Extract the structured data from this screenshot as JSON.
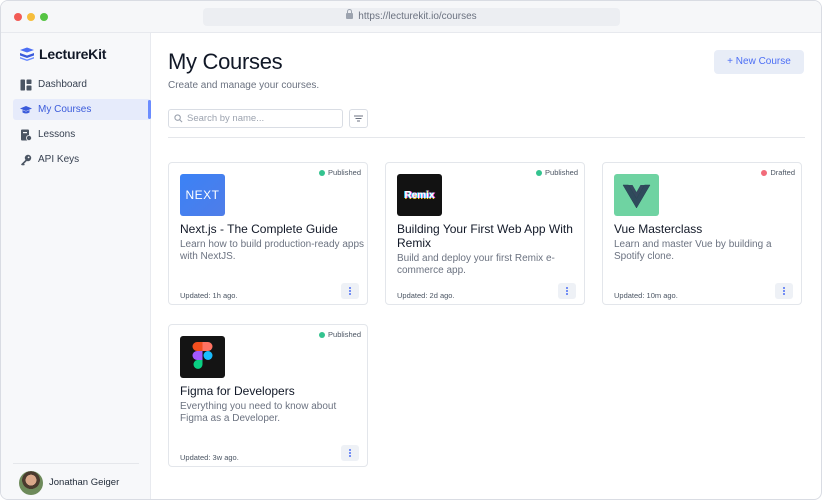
{
  "browser": {
    "url": "https://lecturekit.io/courses"
  },
  "sidebar": {
    "brand": "LectureKit",
    "items": [
      {
        "label": "Dashboard",
        "icon": "dashboard-icon",
        "active": false
      },
      {
        "label": "My Courses",
        "icon": "graduation-cap-icon",
        "active": true
      },
      {
        "label": "Lessons",
        "icon": "lessons-icon",
        "active": false
      },
      {
        "label": "API Keys",
        "icon": "key-icon",
        "active": false
      }
    ],
    "user": {
      "name": "Jonathan Geiger"
    }
  },
  "main": {
    "title": "My Courses",
    "subtitle": "Create and manage your courses.",
    "new_button": "+ New Course",
    "search_placeholder": "Search by name...",
    "courses": [
      {
        "title": "Next.js - The Complete Guide",
        "description": "Learn how to build production-ready apps with NextJS.",
        "status": "Published",
        "updated": "Updated: 1h ago.",
        "thumb_text": "NEXT"
      },
      {
        "title": "Building Your First Web App With Remix",
        "description": "Build and deploy your first Remix e-commerce app.",
        "status": "Published",
        "updated": "Updated: 2d ago.",
        "thumb_text": "Remix"
      },
      {
        "title": "Vue Masterclass",
        "description": "Learn and master Vue by building a Spotify clone.",
        "status": "Drafted",
        "updated": "Updated: 10m ago.",
        "thumb_text": ""
      },
      {
        "title": "Figma for Developers",
        "description": "Everything you need to know about Figma as a Developer.",
        "status": "Published",
        "updated": "Updated: 3w ago.",
        "thumb_text": ""
      }
    ]
  },
  "colors": {
    "accent": "#4c6ef5",
    "published": "#34c38f",
    "drafted": "#f26b7a"
  }
}
